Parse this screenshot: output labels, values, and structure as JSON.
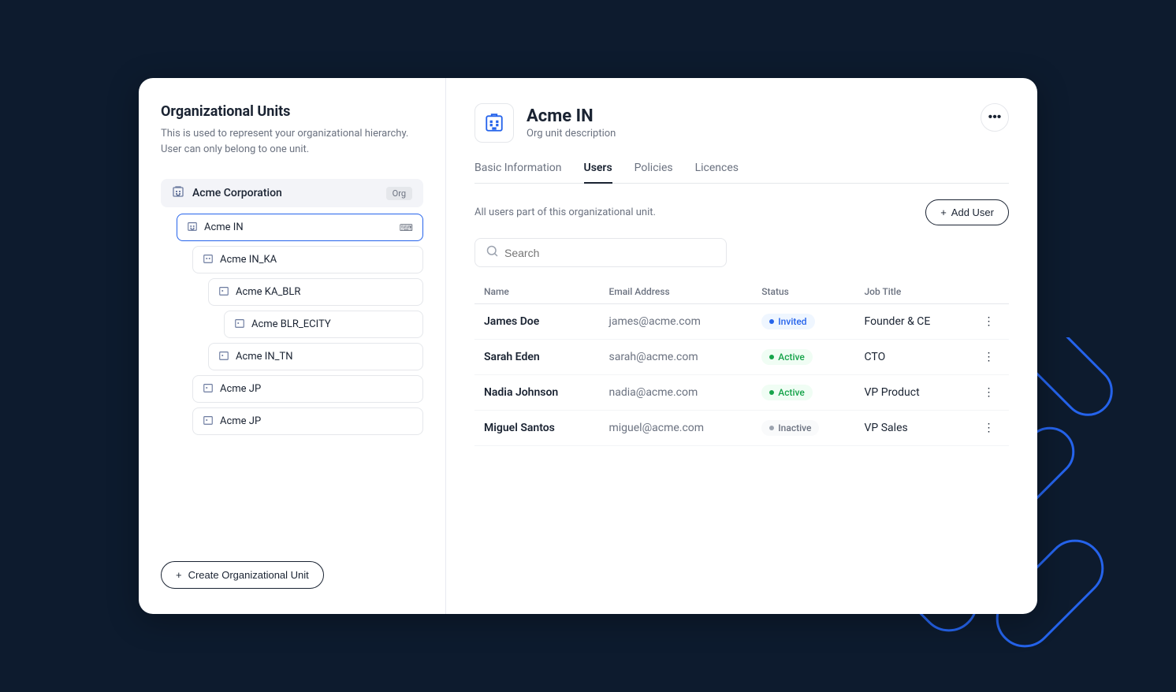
{
  "left": {
    "title": "Organizational Units",
    "description": "This is used to represent your organizational hierarchy. User can only belong to one unit.",
    "create_btn": "Create Organizational Unit",
    "tree": {
      "root": {
        "label": "Acme Corporation",
        "badge": "Org"
      },
      "nodes": [
        {
          "id": "acme-in",
          "label": "Acme IN",
          "level": 1,
          "active": true
        },
        {
          "id": "acme-in-ka",
          "label": "Acme IN_KA",
          "level": 2,
          "active": false
        },
        {
          "id": "acme-ka-blr",
          "label": "Acme KA_BLR",
          "level": 3,
          "active": false
        },
        {
          "id": "acme-blr-ecity",
          "label": "Acme BLR_ECITY",
          "level": 4,
          "active": false
        },
        {
          "id": "acme-in-tn",
          "label": "Acme IN_TN",
          "level": 3,
          "active": false
        },
        {
          "id": "acme-jp",
          "label": "Acme JP",
          "level": 2,
          "active": false
        },
        {
          "id": "acme-jp2",
          "label": "Acme JP",
          "level": 2,
          "active": false
        }
      ]
    }
  },
  "right": {
    "org_name": "Acme IN",
    "org_desc": "Org unit description",
    "tabs": [
      {
        "id": "basic",
        "label": "Basic Information",
        "active": false
      },
      {
        "id": "users",
        "label": "Users",
        "active": true
      },
      {
        "id": "policies",
        "label": "Policies",
        "active": false
      },
      {
        "id": "licences",
        "label": "Licences",
        "active": false
      }
    ],
    "users_description": "All users part of this organizational unit.",
    "add_user_label": "Add User",
    "search_placeholder": "Search",
    "table": {
      "columns": [
        "Name",
        "Email Address",
        "Status",
        "Job Title"
      ],
      "rows": [
        {
          "name": "James Doe",
          "email": "james@acme.com",
          "status": "Invited",
          "status_type": "invited",
          "job": "Founder & CE"
        },
        {
          "name": "Sarah Eden",
          "email": "sarah@acme.com",
          "status": "Active",
          "status_type": "active",
          "job": "CTO"
        },
        {
          "name": "Nadia Johnson",
          "email": "nadia@acme.com",
          "status": "Active",
          "status_type": "active",
          "job": "VP Product"
        },
        {
          "name": "Miguel Santos",
          "email": "miguel@acme.com",
          "status": "Inactive",
          "status_type": "inactive",
          "job": "VP Sales"
        }
      ]
    }
  }
}
